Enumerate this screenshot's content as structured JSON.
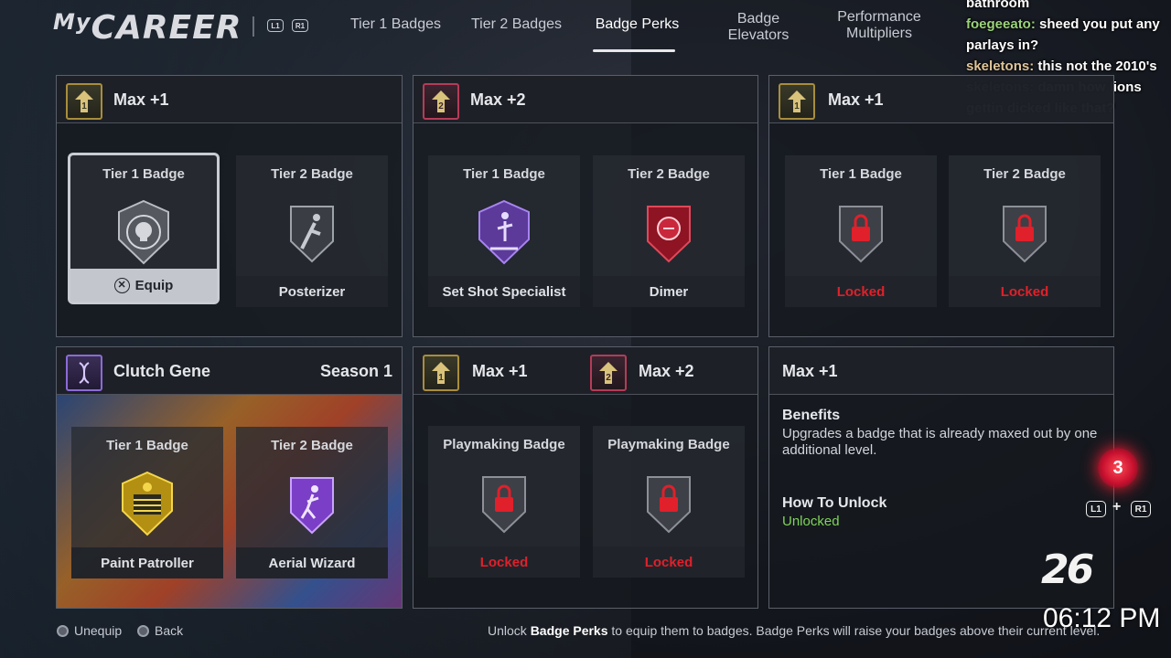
{
  "header": {
    "logo": "MyCAREER",
    "logo_my": "My",
    "logo_rest": "CAREER",
    "left_shoulder": "L1",
    "right_shoulder": "R1",
    "tabs": [
      {
        "label": "Tier 1 Badges"
      },
      {
        "label": "Tier 2 Badges"
      },
      {
        "label": "Badge Perks"
      },
      {
        "label": "Badge Elevators"
      },
      {
        "label": "Performance Multipliers"
      }
    ],
    "active_tab": "Badge Perks"
  },
  "chat": [
    {
      "user": "foegeeato",
      "message": "sheed you put any parlays in?"
    },
    {
      "user": "skeletons",
      "message": "this not the 2010's"
    },
    {
      "user": "skeletons",
      "message": "damn how lions gettin dicked like that?"
    }
  ],
  "chat_fragment": "bathroom",
  "panels": {
    "p1": {
      "title": "Max +1",
      "cards": [
        {
          "label": "Tier 1 Badge",
          "footer": "Equip",
          "icon": "skull-target-badge-icon"
        },
        {
          "label": "Tier 2 Badge",
          "footer": "Posterizer",
          "icon": "posterizer-badge-icon"
        }
      ]
    },
    "p2": {
      "title": "Max +2",
      "cards": [
        {
          "label": "Tier 1 Badge",
          "footer": "Set Shot Specialist",
          "icon": "set-shot-badge-icon"
        },
        {
          "label": "Tier 2 Badge",
          "footer": "Dimer",
          "icon": "dimer-badge-icon"
        }
      ]
    },
    "p3": {
      "title": "Max +1",
      "cards": [
        {
          "label": "Tier 1 Badge",
          "footer": "Locked",
          "icon": "lock-icon"
        },
        {
          "label": "Tier 2 Badge",
          "footer": "Locked",
          "icon": "lock-icon"
        }
      ]
    },
    "p4": {
      "title": "Clutch Gene",
      "season": "Season 1",
      "cards": [
        {
          "label": "Tier 1 Badge",
          "footer": "Paint Patroller",
          "icon": "paint-patroller-badge-icon"
        },
        {
          "label": "Tier 2 Badge",
          "footer": "Aerial Wizard",
          "icon": "aerial-wizard-badge-icon"
        }
      ]
    },
    "p5": {
      "title_a": "Max +1",
      "title_b": "Max +2",
      "cards": [
        {
          "label": "Playmaking Badge",
          "footer": "Locked",
          "icon": "lock-icon"
        },
        {
          "label": "Playmaking Badge",
          "footer": "Locked",
          "icon": "lock-icon"
        }
      ]
    },
    "p6": {
      "title": "Max +1",
      "benefits_title": "Benefits",
      "benefits_text": "Upgrades a badge that is already maxed out by one additional level.",
      "unlock_title": "How To Unlock",
      "unlock_value": "Unlocked"
    }
  },
  "badge_points": "3",
  "combo": {
    "left": "L1",
    "plus": "+",
    "right": "R1"
  },
  "brand": "2K26",
  "brand_display": "26",
  "clock": "06:12 PM",
  "footer": {
    "unequip": "Unequip",
    "back": "Back",
    "hint_pre": "Unlock ",
    "hint_bold": "Badge Perks",
    "hint_post": " to equip them to badges. Badge Perks will raise your badges above their current level."
  },
  "colors": {
    "locked_red": "#e0202a",
    "unlocked_green": "#7fd35a",
    "tier1_gold": "#a88d3c",
    "tier2_red": "#b53c58",
    "clutch_purple": "#8b6bd6"
  }
}
